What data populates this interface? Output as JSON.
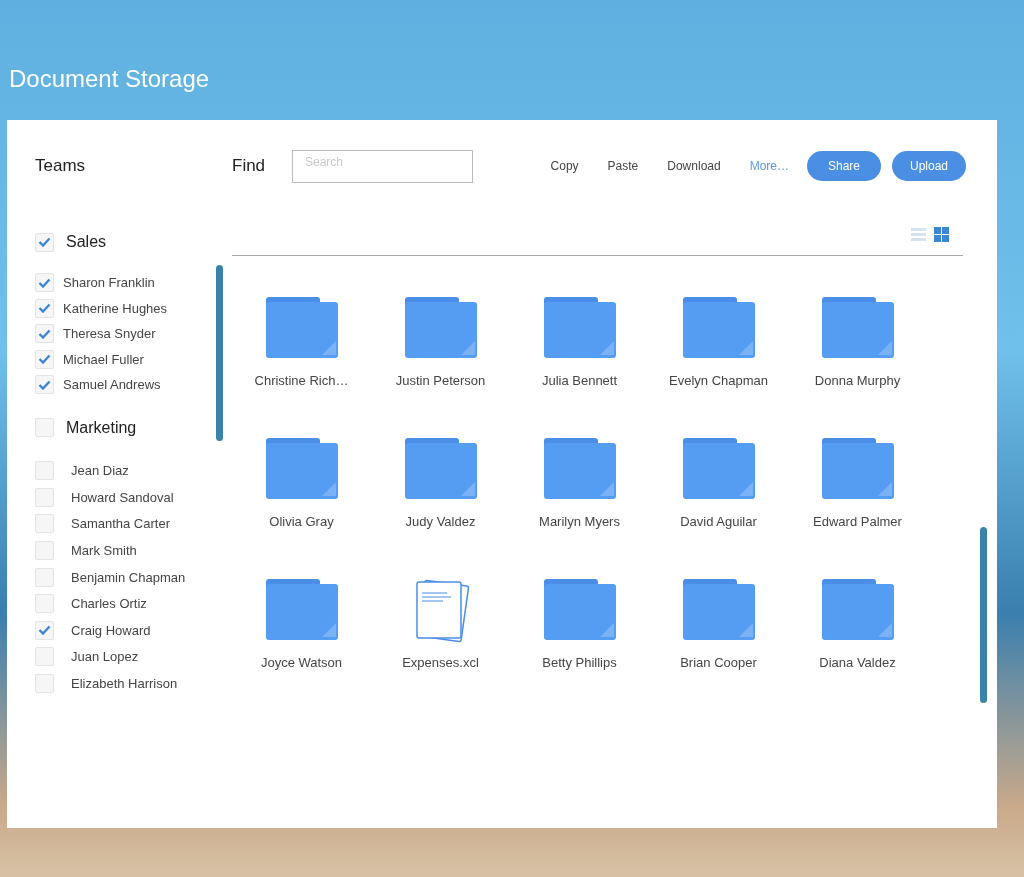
{
  "title": "Document Storage",
  "header": {
    "teams_label": "Teams",
    "find_label": "Find",
    "search": {
      "placeholder": "Search"
    }
  },
  "actions": [
    {
      "label": "Copy",
      "kind": "text"
    },
    {
      "label": "Paste",
      "kind": "text"
    },
    {
      "label": "Download",
      "kind": "text"
    },
    {
      "label": "More…",
      "kind": "link"
    },
    {
      "label": "Share",
      "kind": "primary"
    },
    {
      "label": "Upload",
      "kind": "primary"
    }
  ],
  "sidebar": {
    "groups": [
      {
        "name": "Sales",
        "checked": true,
        "members": [
          {
            "name": "Sharon Franklin",
            "checked": true
          },
          {
            "name": "Katherine Hughes",
            "checked": true
          },
          {
            "name": "Theresa Snyder",
            "checked": true
          },
          {
            "name": "Michael Fuller",
            "checked": true
          },
          {
            "name": "Samuel Andrews",
            "checked": true
          }
        ]
      },
      {
        "name": "Marketing",
        "checked": false,
        "members": [
          {
            "name": "Jean Diaz",
            "checked": false
          },
          {
            "name": "Howard Sandoval",
            "checked": false
          },
          {
            "name": "Samantha Carter",
            "checked": false
          },
          {
            "name": "Mark Smith",
            "checked": false
          },
          {
            "name": "Benjamin Chapman",
            "checked": false
          },
          {
            "name": "Charles Ortiz",
            "checked": false
          },
          {
            "name": "Craig Howard",
            "checked": true
          },
          {
            "name": "Juan Lopez",
            "checked": false
          },
          {
            "name": "Elizabeth Harrison",
            "checked": false
          }
        ]
      }
    ]
  },
  "view_modes": [
    {
      "kind": "list",
      "selected": false
    },
    {
      "kind": "grid",
      "selected": true
    }
  ],
  "items": [
    {
      "name": "Christine Rich…",
      "kind": "folder"
    },
    {
      "name": "Justin Peterson",
      "kind": "folder"
    },
    {
      "name": "Julia Bennett",
      "kind": "folder"
    },
    {
      "name": "Evelyn Chapman",
      "kind": "folder"
    },
    {
      "name": "Donna Murphy",
      "kind": "folder"
    },
    {
      "name": "Olivia Gray",
      "kind": "folder"
    },
    {
      "name": "Judy Valdez",
      "kind": "folder"
    },
    {
      "name": "Marilyn Myers",
      "kind": "folder"
    },
    {
      "name": "David Aguilar",
      "kind": "folder"
    },
    {
      "name": "Edward Palmer",
      "kind": "folder"
    },
    {
      "name": "Joyce Watson",
      "kind": "folder"
    },
    {
      "name": "Expenses.xcl",
      "kind": "document"
    },
    {
      "name": "Betty Phillips",
      "kind": "folder"
    },
    {
      "name": "Brian Cooper",
      "kind": "folder"
    },
    {
      "name": "Diana Valdez",
      "kind": "folder"
    }
  ]
}
